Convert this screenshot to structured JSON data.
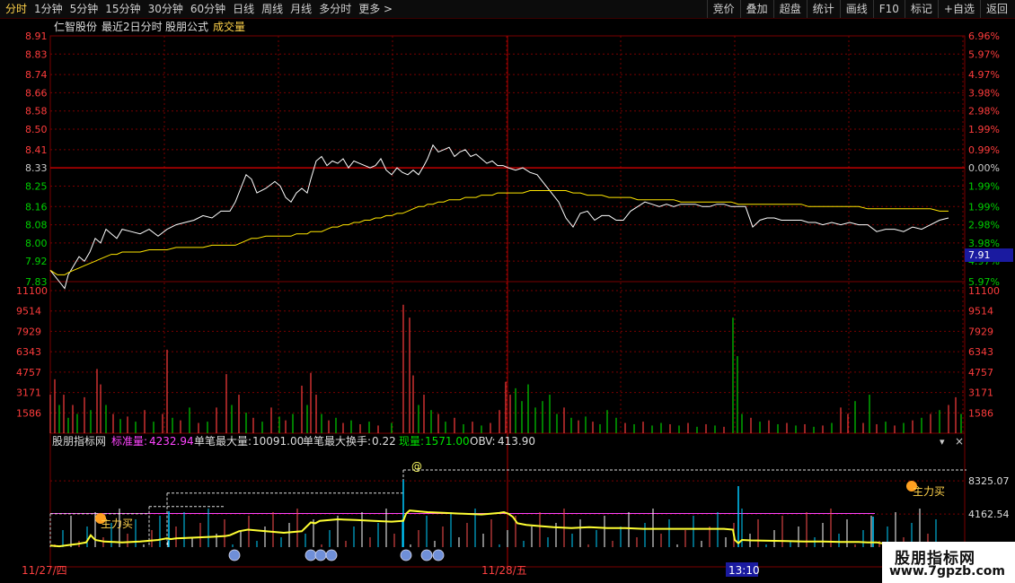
{
  "toolbar": {
    "left": [
      "分时",
      "1分钟",
      "5分钟",
      "15分钟",
      "30分钟",
      "60分钟",
      "日线",
      "周线",
      "月线",
      "多分时",
      "更多 >"
    ],
    "right": [
      "竞价",
      "叠加",
      "超盘",
      "统计",
      "画线",
      "F10",
      "标记",
      "+自选",
      "返回"
    ],
    "active": "分时"
  },
  "header": {
    "stock": "仁智股份",
    "period": "最近2日分时",
    "formula": "股朋公式",
    "volume": "成交量"
  },
  "indicator": {
    "name": "股朋指标网",
    "label1": "标准量:",
    "value1": "4232.94",
    "label2": "单笔最大量:",
    "value2": "10091.00",
    "label3": "单笔最大换手:",
    "value3": "0.22",
    "label4": "现量:",
    "value4": "1571.00",
    "label5": "OBV:",
    "value5": "413.90",
    "marker_at": "@",
    "zhuli1": "主力买",
    "zhuli2": "主力买",
    "close_glyph": "×",
    "menu_glyph": "▾"
  },
  "dates": {
    "d1": "11/27/四",
    "d2": "11/28/五",
    "time": "13:10"
  },
  "cursor_price": "7.91",
  "logo": {
    "line1": "股朋指标网",
    "line2": "www.7gpzb.com"
  },
  "colors": {
    "up": "#ff3c3c",
    "down": "#00d000",
    "price": "#ffffff",
    "avg": "#ffe600",
    "grid": "#7a0000",
    "purple": "#ff44ff"
  },
  "chart_data": [
    {
      "type": "line",
      "title": "仁智股份 最近2日分时",
      "y_ticks": [
        "8.91",
        "8.83",
        "8.74",
        "8.66",
        "8.58",
        "8.50",
        "8.41",
        "8.33",
        "8.25",
        "8.16",
        "8.08",
        "8.00",
        "7.92",
        "7.83"
      ],
      "pct_ticks": [
        "6.96%",
        "5.97%",
        "4.97%",
        "3.98%",
        "2.98%",
        "1.99%",
        "0.99%",
        "0.00%",
        "1.99%",
        "1.99%",
        "2.98%",
        "3.98%",
        "4.97%",
        "5.97%"
      ],
      "ylim": [
        7.83,
        8.91
      ],
      "prev_close": 8.33,
      "x": [
        0,
        4,
        8,
        12,
        16,
        20,
        26,
        32,
        38,
        44,
        50,
        56,
        62,
        68,
        74,
        80,
        90,
        100,
        110,
        120,
        130,
        140,
        150,
        160,
        170,
        180,
        190,
        200,
        206,
        212,
        218,
        224,
        230,
        240,
        250,
        256,
        262,
        268,
        274,
        280,
        286,
        290,
        296,
        302,
        308,
        314,
        320,
        326,
        332,
        338,
        344,
        350,
        356,
        362,
        368,
        374,
        380,
        386,
        392,
        398,
        404,
        410,
        416,
        420,
        426,
        432,
        438,
        444,
        450,
        456,
        462,
        468,
        474,
        480,
        486,
        492,
        498,
        504,
        510,
        518,
        526,
        534,
        542,
        550,
        558,
        566,
        574,
        582,
        590,
        598,
        606,
        614,
        622,
        630,
        638,
        646,
        654,
        662,
        670,
        678,
        686,
        694,
        702,
        710,
        718,
        726,
        734,
        742,
        750,
        758,
        766,
        774,
        782,
        790,
        798,
        806,
        814,
        820,
        828,
        836,
        844,
        852,
        860,
        870,
        880,
        890,
        900,
        910,
        920,
        930,
        940,
        950,
        960,
        970,
        980,
        990,
        1000,
        1010,
        1020
      ],
      "series": [
        {
          "values": [
            7.88,
            7.86,
            7.84,
            7.82,
            7.8,
            7.86,
            7.9,
            7.94,
            7.92,
            7.96,
            8.02,
            8.0,
            8.06,
            8.04,
            8.02,
            8.06,
            8.05,
            8.04,
            8.06,
            8.03,
            8.06,
            8.08,
            8.09,
            8.1,
            8.12,
            8.11,
            8.14,
            8.14,
            8.18,
            8.24,
            8.3,
            8.28,
            8.22,
            8.24,
            8.27,
            8.25,
            8.2,
            8.18,
            8.22,
            8.24,
            8.22,
            8.28,
            8.36,
            8.38,
            8.34,
            8.36,
            8.35,
            8.37,
            8.33,
            8.36,
            8.35,
            8.34,
            8.33,
            8.34,
            8.37,
            8.32,
            8.3,
            8.33,
            8.31,
            8.3,
            8.32,
            8.3,
            8.34,
            8.37,
            8.43,
            8.4,
            8.41,
            8.42,
            8.38,
            8.4,
            8.41,
            8.38,
            8.39,
            8.37,
            8.35,
            8.36,
            8.34,
            8.34,
            8.33,
            8.32,
            8.33,
            8.31,
            8.3,
            8.26,
            8.22,
            8.18,
            8.11,
            8.07,
            8.13,
            8.14,
            8.1,
            8.12,
            8.12,
            8.1,
            8.1,
            8.14,
            8.16,
            8.18,
            8.17,
            8.16,
            8.17,
            8.16,
            8.17,
            8.17,
            8.17,
            8.16,
            8.16,
            8.17,
            8.17,
            8.16,
            8.16,
            8.16,
            8.07,
            8.1,
            8.11,
            8.11,
            8.1,
            8.1,
            8.1,
            8.1,
            8.09,
            8.09,
            8.08,
            8.09,
            8.08,
            8.09,
            8.08,
            8.08,
            8.05,
            8.06,
            8.06,
            8.05,
            8.07,
            8.06,
            8.08,
            8.1,
            8.11
          ]
        },
        {
          "values": [
            7.88,
            7.87,
            7.86,
            7.86,
            7.86,
            7.87,
            7.88,
            7.89,
            7.9,
            7.91,
            7.92,
            7.93,
            7.94,
            7.95,
            7.95,
            7.96,
            7.96,
            7.96,
            7.97,
            7.97,
            7.97,
            7.98,
            7.98,
            7.98,
            7.98,
            7.99,
            7.99,
            7.99,
            7.99,
            8.0,
            8.01,
            8.02,
            8.02,
            8.03,
            8.03,
            8.03,
            8.03,
            8.03,
            8.04,
            8.04,
            8.04,
            8.05,
            8.05,
            8.05,
            8.06,
            8.07,
            8.07,
            8.08,
            8.08,
            8.09,
            8.09,
            8.1,
            8.1,
            8.11,
            8.11,
            8.12,
            8.12,
            8.13,
            8.13,
            8.14,
            8.15,
            8.16,
            8.16,
            8.17,
            8.17,
            8.18,
            8.18,
            8.19,
            8.19,
            8.19,
            8.2,
            8.2,
            8.2,
            8.21,
            8.21,
            8.21,
            8.22,
            8.22,
            8.22,
            8.22,
            8.22,
            8.23,
            8.23,
            8.23,
            8.23,
            8.23,
            8.23,
            8.22,
            8.22,
            8.21,
            8.21,
            8.21,
            8.2,
            8.2,
            8.2,
            8.2,
            8.19,
            8.19,
            8.19,
            8.19,
            8.19,
            8.19,
            8.18,
            8.18,
            8.18,
            8.18,
            8.18,
            8.18,
            8.18,
            8.18,
            8.17,
            8.17,
            8.17,
            8.17,
            8.17,
            8.17,
            8.17,
            8.17,
            8.17,
            8.17,
            8.16,
            8.16,
            8.16,
            8.16,
            8.16,
            8.16,
            8.16,
            8.15,
            8.15,
            8.15,
            8.15,
            8.15,
            8.15,
            8.15,
            8.15,
            8.14,
            8.14
          ]
        }
      ]
    },
    {
      "type": "bar",
      "title": "成交量",
      "y_ticks": [
        "11100",
        "9514",
        "7929",
        "6343",
        "4757",
        "3171",
        "1586"
      ],
      "ylim": [
        0,
        11100
      ],
      "bars": [
        [
          0,
          3000,
          "u"
        ],
        [
          5,
          4200,
          "u"
        ],
        [
          10,
          2200,
          "d"
        ],
        [
          15,
          3000,
          "u"
        ],
        [
          20,
          1200,
          "d"
        ],
        [
          25,
          2200,
          "u"
        ],
        [
          30,
          1500,
          "d"
        ],
        [
          38,
          2800,
          "u"
        ],
        [
          45,
          1800,
          "d"
        ],
        [
          52,
          5000,
          "u"
        ],
        [
          56,
          3800,
          "u"
        ],
        [
          62,
          2200,
          "d"
        ],
        [
          70,
          1500,
          "u"
        ],
        [
          78,
          1100,
          "d"
        ],
        [
          86,
          1300,
          "u"
        ],
        [
          95,
          900,
          "d"
        ],
        [
          105,
          1800,
          "u"
        ],
        [
          115,
          900,
          "d"
        ],
        [
          125,
          1500,
          "u"
        ],
        [
          130,
          6500,
          "u"
        ],
        [
          136,
          1200,
          "d"
        ],
        [
          145,
          1000,
          "u"
        ],
        [
          155,
          2000,
          "d"
        ],
        [
          165,
          800,
          "u"
        ],
        [
          175,
          900,
          "d"
        ],
        [
          185,
          2000,
          "u"
        ],
        [
          196,
          4600,
          "u"
        ],
        [
          202,
          2200,
          "d"
        ],
        [
          210,
          3000,
          "u"
        ],
        [
          218,
          1600,
          "d"
        ],
        [
          226,
          1200,
          "u"
        ],
        [
          236,
          900,
          "d"
        ],
        [
          246,
          2000,
          "u"
        ],
        [
          255,
          1300,
          "d"
        ],
        [
          262,
          1000,
          "u"
        ],
        [
          270,
          1500,
          "d"
        ],
        [
          280,
          3700,
          "u"
        ],
        [
          286,
          2200,
          "d"
        ],
        [
          290,
          4700,
          "u"
        ],
        [
          296,
          3000,
          "u"
        ],
        [
          302,
          1500,
          "d"
        ],
        [
          310,
          1000,
          "u"
        ],
        [
          318,
          1200,
          "d"
        ],
        [
          326,
          800,
          "u"
        ],
        [
          335,
          1000,
          "d"
        ],
        [
          345,
          700,
          "u"
        ],
        [
          355,
          900,
          "d"
        ],
        [
          365,
          600,
          "u"
        ],
        [
          380,
          800,
          "d"
        ],
        [
          393,
          10000,
          "u"
        ],
        [
          400,
          9000,
          "u"
        ],
        [
          404,
          4500,
          "u"
        ],
        [
          410,
          2200,
          "d"
        ],
        [
          416,
          3000,
          "u"
        ],
        [
          424,
          1800,
          "d"
        ],
        [
          432,
          1500,
          "u"
        ],
        [
          440,
          900,
          "d"
        ],
        [
          450,
          1200,
          "u"
        ],
        [
          460,
          700,
          "d"
        ],
        [
          470,
          900,
          "u"
        ],
        [
          480,
          600,
          "d"
        ],
        [
          490,
          800,
          "u"
        ],
        [
          500,
          1800,
          "u"
        ],
        [
          507,
          4000,
          "u"
        ],
        [
          512,
          3000,
          "u"
        ],
        [
          518,
          3500,
          "d"
        ],
        [
          525,
          2500,
          "d"
        ],
        [
          532,
          3800,
          "d"
        ],
        [
          540,
          2000,
          "d"
        ],
        [
          548,
          2500,
          "d"
        ],
        [
          556,
          3000,
          "d"
        ],
        [
          564,
          1500,
          "d"
        ],
        [
          572,
          2000,
          "u"
        ],
        [
          580,
          1200,
          "d"
        ],
        [
          588,
          1000,
          "u"
        ],
        [
          596,
          1300,
          "d"
        ],
        [
          604,
          900,
          "u"
        ],
        [
          612,
          700,
          "d"
        ],
        [
          620,
          1800,
          "d"
        ],
        [
          630,
          1200,
          "d"
        ],
        [
          640,
          800,
          "u"
        ],
        [
          650,
          700,
          "d"
        ],
        [
          660,
          900,
          "u"
        ],
        [
          670,
          600,
          "d"
        ],
        [
          680,
          800,
          "d"
        ],
        [
          690,
          700,
          "u"
        ],
        [
          700,
          600,
          "d"
        ],
        [
          710,
          800,
          "u"
        ],
        [
          720,
          500,
          "d"
        ],
        [
          730,
          700,
          "u"
        ],
        [
          740,
          600,
          "d"
        ],
        [
          750,
          500,
          "u"
        ],
        [
          760,
          9000,
          "d"
        ],
        [
          765,
          6000,
          "d"
        ],
        [
          770,
          1500,
          "d"
        ],
        [
          780,
          1200,
          "u"
        ],
        [
          790,
          900,
          "d"
        ],
        [
          800,
          1000,
          "u"
        ],
        [
          810,
          700,
          "d"
        ],
        [
          820,
          800,
          "u"
        ],
        [
          830,
          600,
          "d"
        ],
        [
          840,
          700,
          "u"
        ],
        [
          850,
          500,
          "d"
        ],
        [
          860,
          600,
          "u"
        ],
        [
          870,
          800,
          "d"
        ],
        [
          880,
          2000,
          "u"
        ],
        [
          888,
          1500,
          "u"
        ],
        [
          896,
          2500,
          "d"
        ],
        [
          905,
          800,
          "u"
        ],
        [
          912,
          3000,
          "d"
        ],
        [
          920,
          700,
          "u"
        ],
        [
          930,
          900,
          "d"
        ],
        [
          940,
          600,
          "u"
        ],
        [
          950,
          800,
          "d"
        ],
        [
          960,
          1000,
          "u"
        ],
        [
          970,
          1200,
          "d"
        ],
        [
          980,
          1500,
          "u"
        ],
        [
          990,
          1800,
          "d"
        ],
        [
          1000,
          2200,
          "u"
        ],
        [
          1008,
          2800,
          "u"
        ],
        [
          1014,
          1500,
          "d"
        ]
      ]
    },
    {
      "type": "line",
      "title": "股朋指标网",
      "y_ticks": [
        "8325.07",
        "4162.54"
      ],
      "ylim": [
        0,
        10600
      ],
      "x": [
        0,
        10,
        20,
        30,
        40,
        45,
        50,
        60,
        70,
        80,
        90,
        100,
        110,
        120,
        130,
        134,
        140,
        160,
        180,
        195,
        200,
        210,
        220,
        240,
        260,
        280,
        290,
        295,
        300,
        320,
        340,
        360,
        380,
        393,
        396,
        400,
        420,
        440,
        460,
        480,
        500,
        505,
        510,
        515,
        520,
        530,
        540,
        560,
        580,
        600,
        620,
        640,
        660,
        680,
        700,
        720,
        740,
        750,
        760,
        762,
        766,
        770,
        780,
        800,
        820,
        840,
        860,
        880,
        900,
        910,
        920,
        930
      ],
      "series": [
        {
          "name": "股朋指标网",
          "values": [
            200,
            100,
            250,
            400,
            600,
            1500,
            900,
            700,
            650,
            600,
            650,
            700,
            800,
            900,
            1100,
            1000,
            1100,
            1200,
            1300,
            1400,
            1500,
            2000,
            2200,
            2000,
            1800,
            2000,
            3100,
            3000,
            3300,
            3500,
            3400,
            3300,
            3200,
            3300,
            4200,
            4600,
            4400,
            4300,
            4200,
            4100,
            4300,
            4400,
            4200,
            3800,
            3000,
            2800,
            2700,
            2500,
            2400,
            2500,
            2400,
            2400,
            2300,
            2300,
            2300,
            2300,
            2300,
            2300,
            2200,
            900,
            500,
            900,
            850,
            800,
            750,
            700,
            700,
            650,
            650,
            600,
            600,
            400
          ]
        }
      ],
      "standard_level": 4232.94,
      "step_levels": [
        [
          0,
          110,
          4200
        ],
        [
          110,
          195,
          5100
        ],
        [
          130,
          393,
          6800
        ],
        [
          393,
          1020,
          9700
        ]
      ]
    }
  ]
}
